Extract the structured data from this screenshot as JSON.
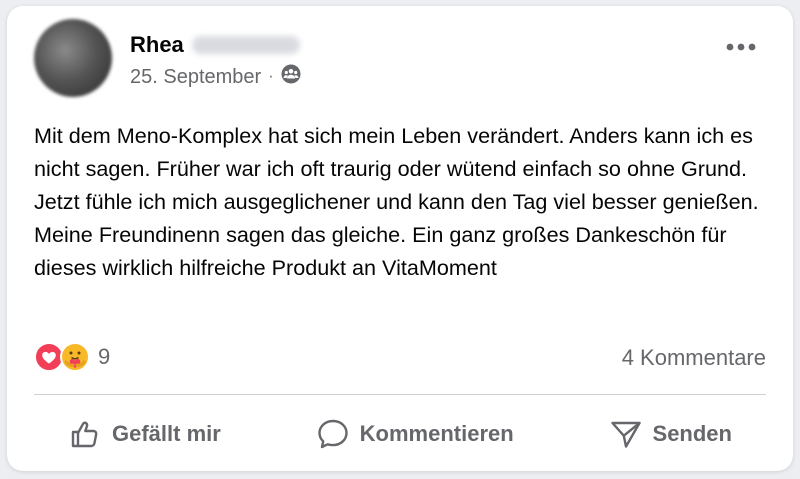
{
  "post": {
    "author_first_name": "Rhea",
    "date": "25. September",
    "separator": "·",
    "audience_icon": "friends-audience-icon",
    "text": "Mit dem Meno-Komplex hat sich mein Leben verändert. Anders kann ich es nicht sagen. Früher war ich oft traurig oder wütend einfach so ohne Grund. Jetzt fühle ich mich ausgeglichener und kann den Tag viel besser genießen. Meine Freundinenn sagen das gleiche. Ein ganz großes Dankeschön für dieses wirklich hilfreiche Produkt an VitaMoment"
  },
  "reactions": {
    "icons": [
      "love-reaction-icon",
      "care-reaction-icon"
    ],
    "count": "9"
  },
  "comments_count": "4 Kommentare",
  "actions": {
    "like_label": "Gefällt mir",
    "comment_label": "Kommentieren",
    "share_label": "Senden"
  },
  "colors": {
    "secondary_text": "#65676b",
    "love_red": "#f33e58",
    "care_yellow": "#f7b928"
  }
}
